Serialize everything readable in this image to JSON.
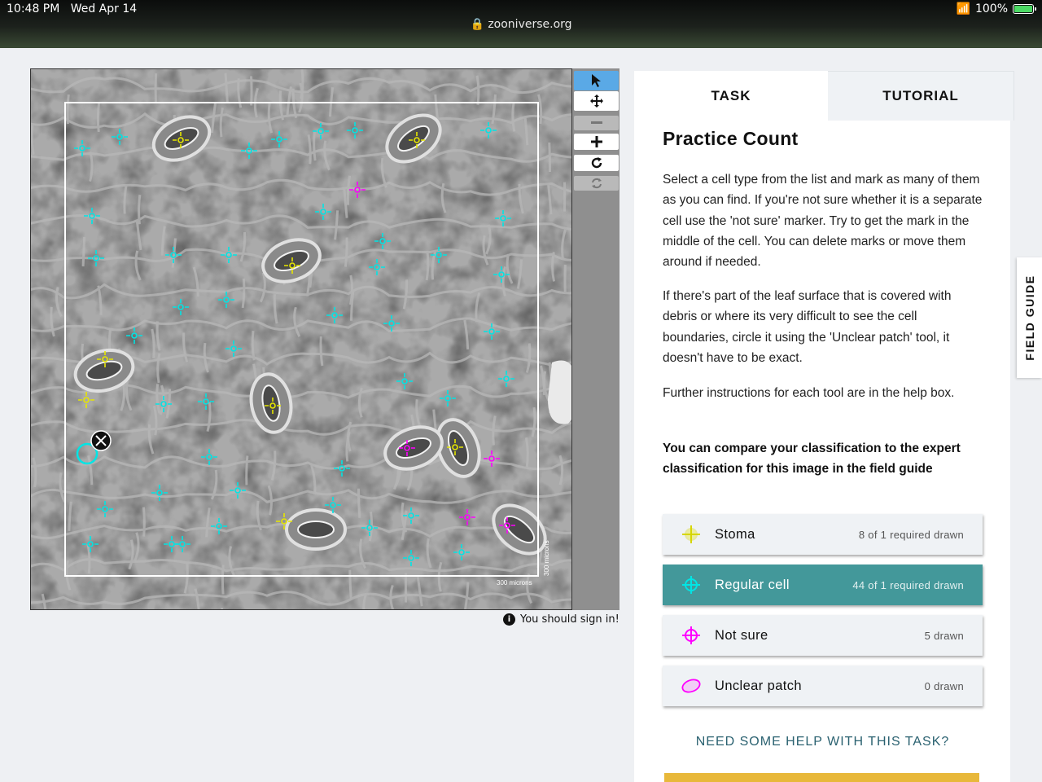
{
  "status_bar": {
    "time": "10:48 PM",
    "date": "Wed Apr 14",
    "battery": "100%",
    "url": "zooniverse.org"
  },
  "toolbar": {
    "pointer": "pointer-icon",
    "pan": "move-arrows-icon",
    "zoom_out": "minus-icon",
    "zoom_in": "plus-icon",
    "rotate": "rotate-icon",
    "reset": "reset-icon"
  },
  "image": {
    "scale_label": "300 microns"
  },
  "signin_text": "You should sign in!",
  "tabs": {
    "task": "TASK",
    "tutorial": "TUTORIAL"
  },
  "task": {
    "title": "Practice Count",
    "para1": "Select a cell type from the list and mark as many of them as you can find. If you're not sure whether it is a separate cell use the 'not sure' marker. Try to get the mark in the middle of the cell. You can delete marks or move them around if needed.",
    "para2": "If there's part of the leaf surface that is covered with debris or where its very difficult to see the cell boundaries, circle it using the 'Unclear patch' tool, it doesn't have to be exact.",
    "para3": "Further instructions for each tool are in the help box.",
    "para4": "You can compare your classification to the expert classification for this image in the field guide",
    "tools": [
      {
        "label": "Stoma",
        "count": "8 of 1 required drawn",
        "color": "#e6e600",
        "icon": "crosshair-icon"
      },
      {
        "label": "Regular cell",
        "count": "44 of 1 required drawn",
        "color": "#00e5e5",
        "icon": "crosshair-icon"
      },
      {
        "label": "Not sure",
        "count": "5 drawn",
        "color": "#ff00ff",
        "icon": "crosshair-icon"
      },
      {
        "label": "Unclear patch",
        "count": "0 drawn",
        "color": "#ff00ff",
        "icon": "ellipse-icon"
      }
    ],
    "help": "NEED SOME HELP WITH THIS TASK?"
  },
  "field_guide": "FIELD GUIDE"
}
